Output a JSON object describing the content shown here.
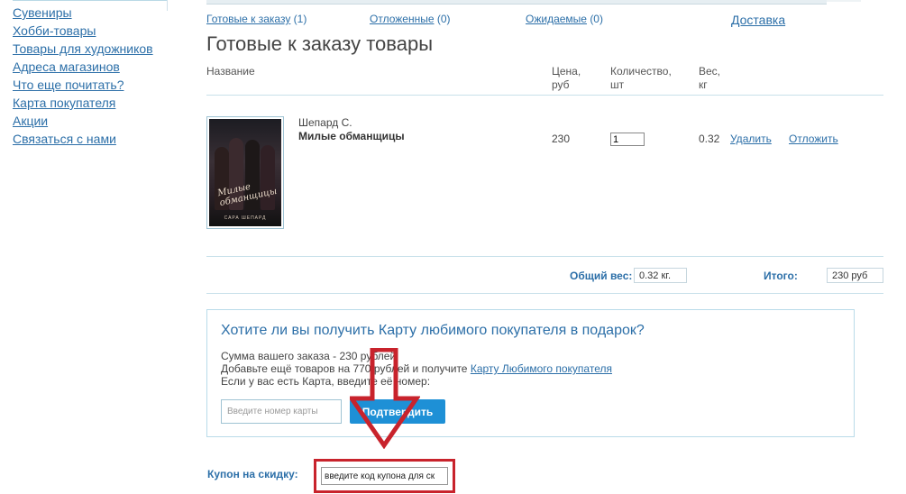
{
  "sidebar": {
    "items": [
      {
        "label": "Сувениры"
      },
      {
        "label": "Хобби-товары"
      },
      {
        "label": "Товары для художников"
      },
      {
        "label": "Адреса магазинов"
      },
      {
        "label": "Что еще почитать?"
      },
      {
        "label": "Карта покупателя"
      },
      {
        "label": "Акции"
      },
      {
        "label": "Связаться с нами"
      }
    ]
  },
  "tabs": {
    "ready": {
      "label": "Готовые к заказу",
      "count": "(1)"
    },
    "deferred": {
      "label": "Отложенные",
      "count": "(0)"
    },
    "expected": {
      "label": "Ожидаемые",
      "count": "(0)"
    },
    "delivery": {
      "label": "Доставка"
    }
  },
  "page_title": "Готовые к заказу товары",
  "table": {
    "headers": {
      "name": "Название",
      "price_1": "Цена,",
      "price_2": "руб",
      "qty_1": "Количество,",
      "qty_2": "шт",
      "weight_1": "Вес,",
      "weight_2": "кг"
    },
    "rows": [
      {
        "author": "Шепард С.",
        "title": "Милые обманщицы",
        "price": "230",
        "quantity": "1",
        "weight": "0.32",
        "delete_label": "Удалить",
        "defer_label": "Отложить"
      }
    ]
  },
  "totals": {
    "weight_label": "Общий вес:",
    "weight_value": "0.32 кг.",
    "total_label": "Итого:",
    "total_value": "230 руб"
  },
  "promo": {
    "title": "Хотите ли вы получить Карту любимого покупателя в подарок?",
    "line1": "Сумма вашего заказа - 230 рублей",
    "line2_prefix": "Добавьте ещё товаров на 770 рублей и получите",
    "line2_link": "Карту Любимого покупателя",
    "line3": "Если у вас есть Карта, введите её номер:",
    "card_placeholder": "Введите номер карты",
    "confirm_label": "Подтвердить"
  },
  "coupon": {
    "label": "Купон на скидку:",
    "placeholder": "введите код купона для ск"
  },
  "colors": {
    "link": "#2c6fa8",
    "button": "#1e90d6",
    "highlight": "#c8232c",
    "divider": "#c8e1ea"
  }
}
